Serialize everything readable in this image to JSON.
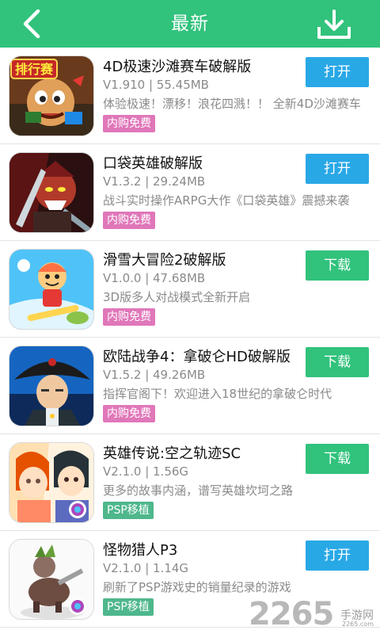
{
  "header": {
    "title": "最新",
    "back_icon": "chevron-left-icon",
    "download_icon": "download-tray-icon"
  },
  "colors": {
    "header_bg": "#31c27c",
    "open_button": "#29a8e6",
    "download_button": "#31c27c",
    "badge_iap": "#e077b9",
    "badge_psp": "#4eb78c"
  },
  "apps": [
    {
      "name": "4D极速沙滩赛车破解版",
      "version": "V1.910 | 55.45MB",
      "description": "体验极速！漂移！浪花四溅！！ 全新4D沙滩赛车",
      "badge": "内购免费",
      "badge_type": "iap",
      "button": "打开",
      "button_type": "open",
      "icon_overlay_text": "排行赛"
    },
    {
      "name": "口袋英雄破解版",
      "version": "V1.3.2 | 29.24MB",
      "description": "战斗实时操作ARPG大作《口袋英雄》震撼来袭",
      "badge": "内购免费",
      "badge_type": "iap",
      "button": "打开",
      "button_type": "open"
    },
    {
      "name": "滑雪大冒险2破解版",
      "version": "V1.0.0 | 47.68MB",
      "description": "3D版多人对战模式全新开启",
      "badge": "内购免费",
      "badge_type": "iap",
      "button": "下载",
      "button_type": "download"
    },
    {
      "name": "欧陆战争4：拿破仑HD破解版",
      "version": "V1.5.2 | 49.26MB",
      "description": "指挥官阁下！欢迎进入18世纪的拿破仑时代",
      "badge": "内购免费",
      "badge_type": "iap",
      "button": "下载",
      "button_type": "download"
    },
    {
      "name": "英雄传说:空之轨迹SC",
      "version": "V2.1.0 | 1.56G",
      "description": "更多的故事内涵，谱写英雄坎坷之路",
      "badge": "PSP移植",
      "badge_type": "psp",
      "button": "下载",
      "button_type": "download"
    },
    {
      "name": "怪物猎人P3",
      "version": "V2.1.0 | 1.14G",
      "description": "刷新了PSP游戏史的销量纪录的游戏",
      "badge": "PSP移植",
      "badge_type": "psp",
      "button": "打开",
      "button_type": "open"
    }
  ],
  "watermark": {
    "number": "2265",
    "text": "手游网",
    "url": "2265.com"
  }
}
